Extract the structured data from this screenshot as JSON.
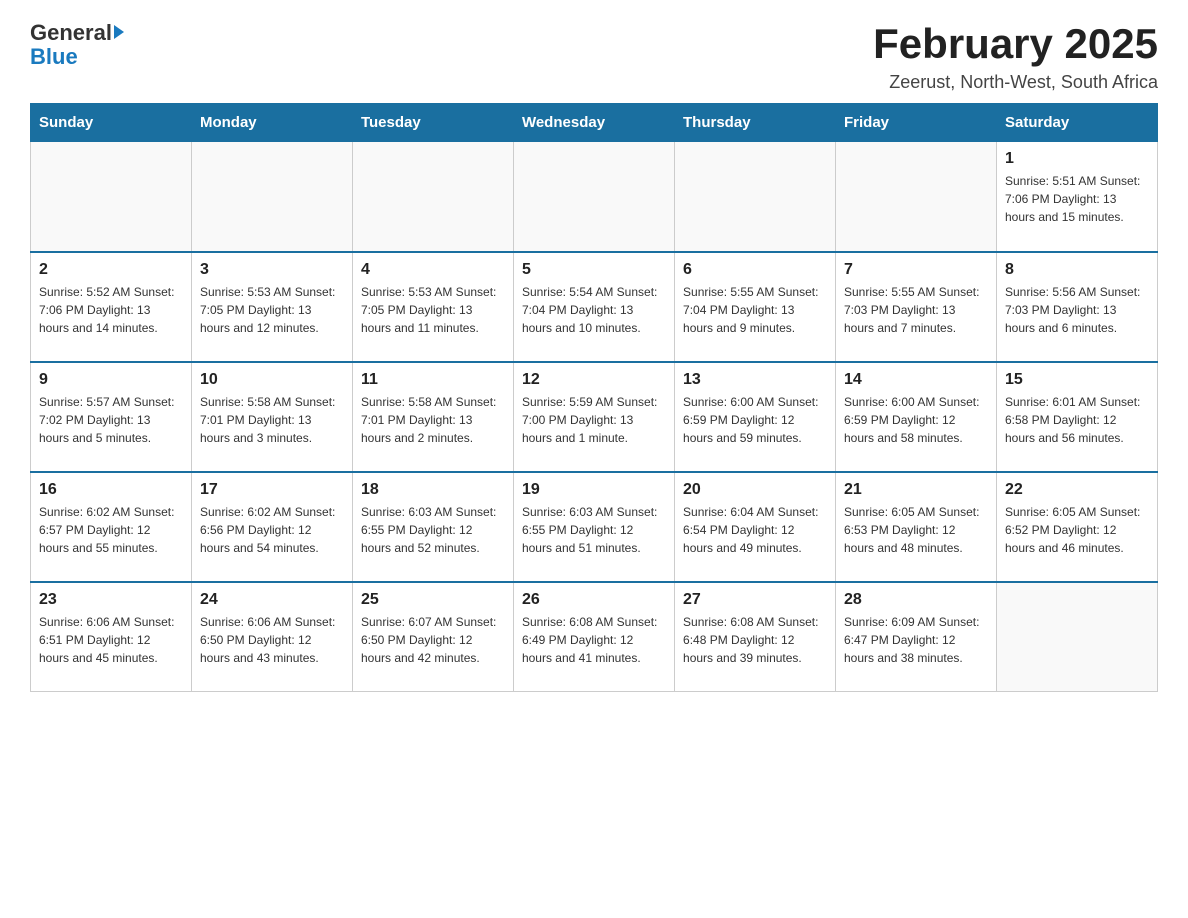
{
  "logo": {
    "general": "General",
    "blue": "Blue"
  },
  "header": {
    "title": "February 2025",
    "subtitle": "Zeerust, North-West, South Africa"
  },
  "weekdays": [
    "Sunday",
    "Monday",
    "Tuesday",
    "Wednesday",
    "Thursday",
    "Friday",
    "Saturday"
  ],
  "weeks": [
    [
      {
        "day": "",
        "info": ""
      },
      {
        "day": "",
        "info": ""
      },
      {
        "day": "",
        "info": ""
      },
      {
        "day": "",
        "info": ""
      },
      {
        "day": "",
        "info": ""
      },
      {
        "day": "",
        "info": ""
      },
      {
        "day": "1",
        "info": "Sunrise: 5:51 AM\nSunset: 7:06 PM\nDaylight: 13 hours and 15 minutes."
      }
    ],
    [
      {
        "day": "2",
        "info": "Sunrise: 5:52 AM\nSunset: 7:06 PM\nDaylight: 13 hours and 14 minutes."
      },
      {
        "day": "3",
        "info": "Sunrise: 5:53 AM\nSunset: 7:05 PM\nDaylight: 13 hours and 12 minutes."
      },
      {
        "day": "4",
        "info": "Sunrise: 5:53 AM\nSunset: 7:05 PM\nDaylight: 13 hours and 11 minutes."
      },
      {
        "day": "5",
        "info": "Sunrise: 5:54 AM\nSunset: 7:04 PM\nDaylight: 13 hours and 10 minutes."
      },
      {
        "day": "6",
        "info": "Sunrise: 5:55 AM\nSunset: 7:04 PM\nDaylight: 13 hours and 9 minutes."
      },
      {
        "day": "7",
        "info": "Sunrise: 5:55 AM\nSunset: 7:03 PM\nDaylight: 13 hours and 7 minutes."
      },
      {
        "day": "8",
        "info": "Sunrise: 5:56 AM\nSunset: 7:03 PM\nDaylight: 13 hours and 6 minutes."
      }
    ],
    [
      {
        "day": "9",
        "info": "Sunrise: 5:57 AM\nSunset: 7:02 PM\nDaylight: 13 hours and 5 minutes."
      },
      {
        "day": "10",
        "info": "Sunrise: 5:58 AM\nSunset: 7:01 PM\nDaylight: 13 hours and 3 minutes."
      },
      {
        "day": "11",
        "info": "Sunrise: 5:58 AM\nSunset: 7:01 PM\nDaylight: 13 hours and 2 minutes."
      },
      {
        "day": "12",
        "info": "Sunrise: 5:59 AM\nSunset: 7:00 PM\nDaylight: 13 hours and 1 minute."
      },
      {
        "day": "13",
        "info": "Sunrise: 6:00 AM\nSunset: 6:59 PM\nDaylight: 12 hours and 59 minutes."
      },
      {
        "day": "14",
        "info": "Sunrise: 6:00 AM\nSunset: 6:59 PM\nDaylight: 12 hours and 58 minutes."
      },
      {
        "day": "15",
        "info": "Sunrise: 6:01 AM\nSunset: 6:58 PM\nDaylight: 12 hours and 56 minutes."
      }
    ],
    [
      {
        "day": "16",
        "info": "Sunrise: 6:02 AM\nSunset: 6:57 PM\nDaylight: 12 hours and 55 minutes."
      },
      {
        "day": "17",
        "info": "Sunrise: 6:02 AM\nSunset: 6:56 PM\nDaylight: 12 hours and 54 minutes."
      },
      {
        "day": "18",
        "info": "Sunrise: 6:03 AM\nSunset: 6:55 PM\nDaylight: 12 hours and 52 minutes."
      },
      {
        "day": "19",
        "info": "Sunrise: 6:03 AM\nSunset: 6:55 PM\nDaylight: 12 hours and 51 minutes."
      },
      {
        "day": "20",
        "info": "Sunrise: 6:04 AM\nSunset: 6:54 PM\nDaylight: 12 hours and 49 minutes."
      },
      {
        "day": "21",
        "info": "Sunrise: 6:05 AM\nSunset: 6:53 PM\nDaylight: 12 hours and 48 minutes."
      },
      {
        "day": "22",
        "info": "Sunrise: 6:05 AM\nSunset: 6:52 PM\nDaylight: 12 hours and 46 minutes."
      }
    ],
    [
      {
        "day": "23",
        "info": "Sunrise: 6:06 AM\nSunset: 6:51 PM\nDaylight: 12 hours and 45 minutes."
      },
      {
        "day": "24",
        "info": "Sunrise: 6:06 AM\nSunset: 6:50 PM\nDaylight: 12 hours and 43 minutes."
      },
      {
        "day": "25",
        "info": "Sunrise: 6:07 AM\nSunset: 6:50 PM\nDaylight: 12 hours and 42 minutes."
      },
      {
        "day": "26",
        "info": "Sunrise: 6:08 AM\nSunset: 6:49 PM\nDaylight: 12 hours and 41 minutes."
      },
      {
        "day": "27",
        "info": "Sunrise: 6:08 AM\nSunset: 6:48 PM\nDaylight: 12 hours and 39 minutes."
      },
      {
        "day": "28",
        "info": "Sunrise: 6:09 AM\nSunset: 6:47 PM\nDaylight: 12 hours and 38 minutes."
      },
      {
        "day": "",
        "info": ""
      }
    ]
  ]
}
